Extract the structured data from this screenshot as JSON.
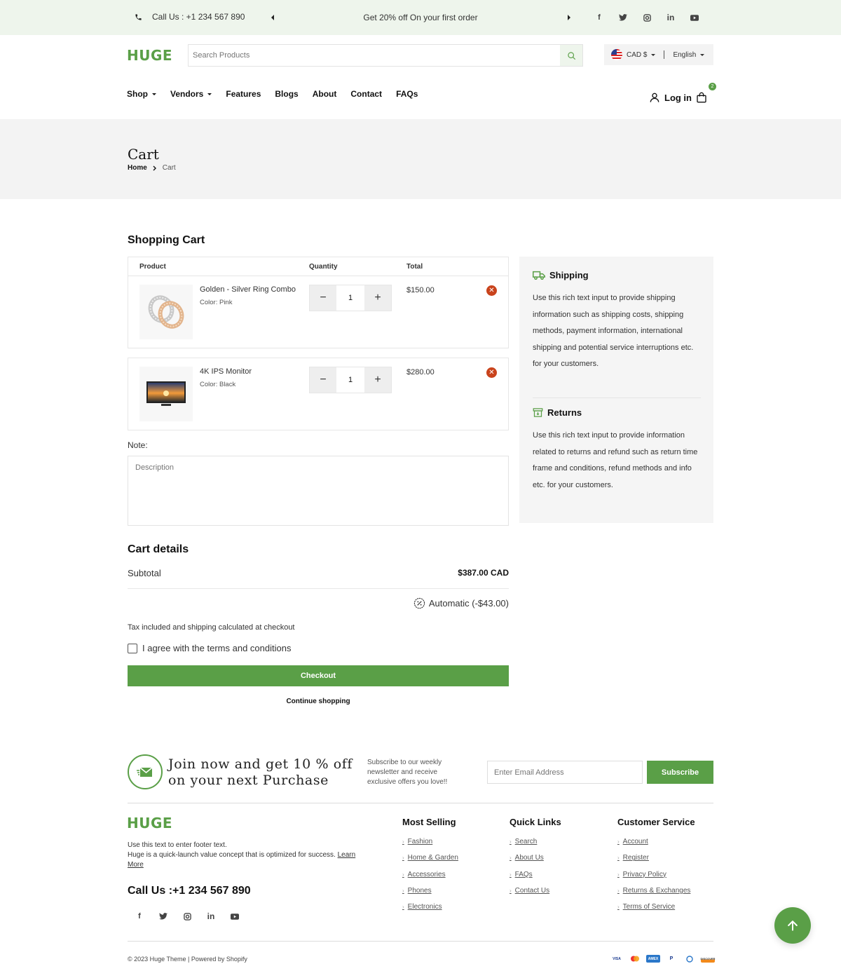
{
  "topbar": {
    "phone": "Call Us : +1 234 567 890",
    "promo": "Get 20% off On your first order"
  },
  "header": {
    "logo": "HUGE",
    "search_placeholder": "Search Products",
    "currency": "CAD $",
    "language": "English",
    "login": "Log in",
    "cart_count": "2"
  },
  "nav": {
    "shop": "Shop",
    "vendors": "Vendors",
    "features": "Features",
    "blogs": "Blogs",
    "about": "About",
    "contact": "Contact",
    "faqs": "FAQs"
  },
  "page": {
    "title": "Cart",
    "breadcrumb_home": "Home",
    "breadcrumb_current": "Cart"
  },
  "cart": {
    "heading": "Shopping Cart",
    "col_product": "Product",
    "col_quantity": "Quantity",
    "col_total": "Total",
    "items": [
      {
        "name": "Golden - Silver Ring Combo",
        "variant": "Color: Pink",
        "qty": "1",
        "total": "$150.00"
      },
      {
        "name": "4K IPS Monitor",
        "variant": "Color: Black",
        "qty": "1",
        "total": "$280.00"
      }
    ],
    "note_label": "Note:",
    "note_placeholder": "Description"
  },
  "info": {
    "shipping_title": "Shipping",
    "shipping_text": "Use this rich text input to provide shipping information such as shipping costs, shipping methods, payment information, international shipping and potential service interruptions etc. for your customers.",
    "returns_title": "Returns",
    "returns_text": "Use this rich text input to provide information related to returns and refund such as return time frame and conditions, refund methods and info etc. for your customers."
  },
  "details": {
    "heading": "Cart details",
    "subtotal_label": "Subtotal",
    "subtotal_value": "$387.00 CAD",
    "discount": "Automatic (-$43.00)",
    "tax_note": "Tax included and shipping calculated at checkout",
    "terms": "I agree with the terms and conditions",
    "checkout": "Checkout",
    "continue": "Continue shopping"
  },
  "newsletter": {
    "headline_1": "Join now and get 10 % off",
    "headline_2": "on your next Purchase",
    "sub_1": "Subscribe to our weekly",
    "sub_2": "newsletter and receive",
    "sub_3": "exclusive offers you love!!",
    "email_placeholder": "Enter Email Address",
    "subscribe": "Subscribe"
  },
  "footer": {
    "logo": "HUGE",
    "text_1": "Use this text to enter footer text.",
    "text_2": "Huge is a quick-launch value concept that is optimized for success.",
    "learn": "Learn",
    "more": "More",
    "call": "Call Us :+1 234 567 890",
    "most_selling_title": "Most Selling",
    "most_selling": [
      "Fashion",
      "Home & Garden",
      "Accessories",
      "Phones",
      "Electronics"
    ],
    "quick_links_title": "Quick Links",
    "quick_links": [
      "Search",
      "About Us",
      "FAQs",
      "Contact Us"
    ],
    "customer_service_title": "Customer Service",
    "customer_service": [
      "Account",
      "Register",
      "Privacy Policy",
      "Returns & Exchanges",
      "Terms of Service"
    ],
    "copyright": "© 2023 Huge Theme | Powered by Shopify"
  },
  "colors": {
    "brand_green": "#5a9f47",
    "remove_red": "#c9431c",
    "topbar_bg": "#eef5ec"
  }
}
